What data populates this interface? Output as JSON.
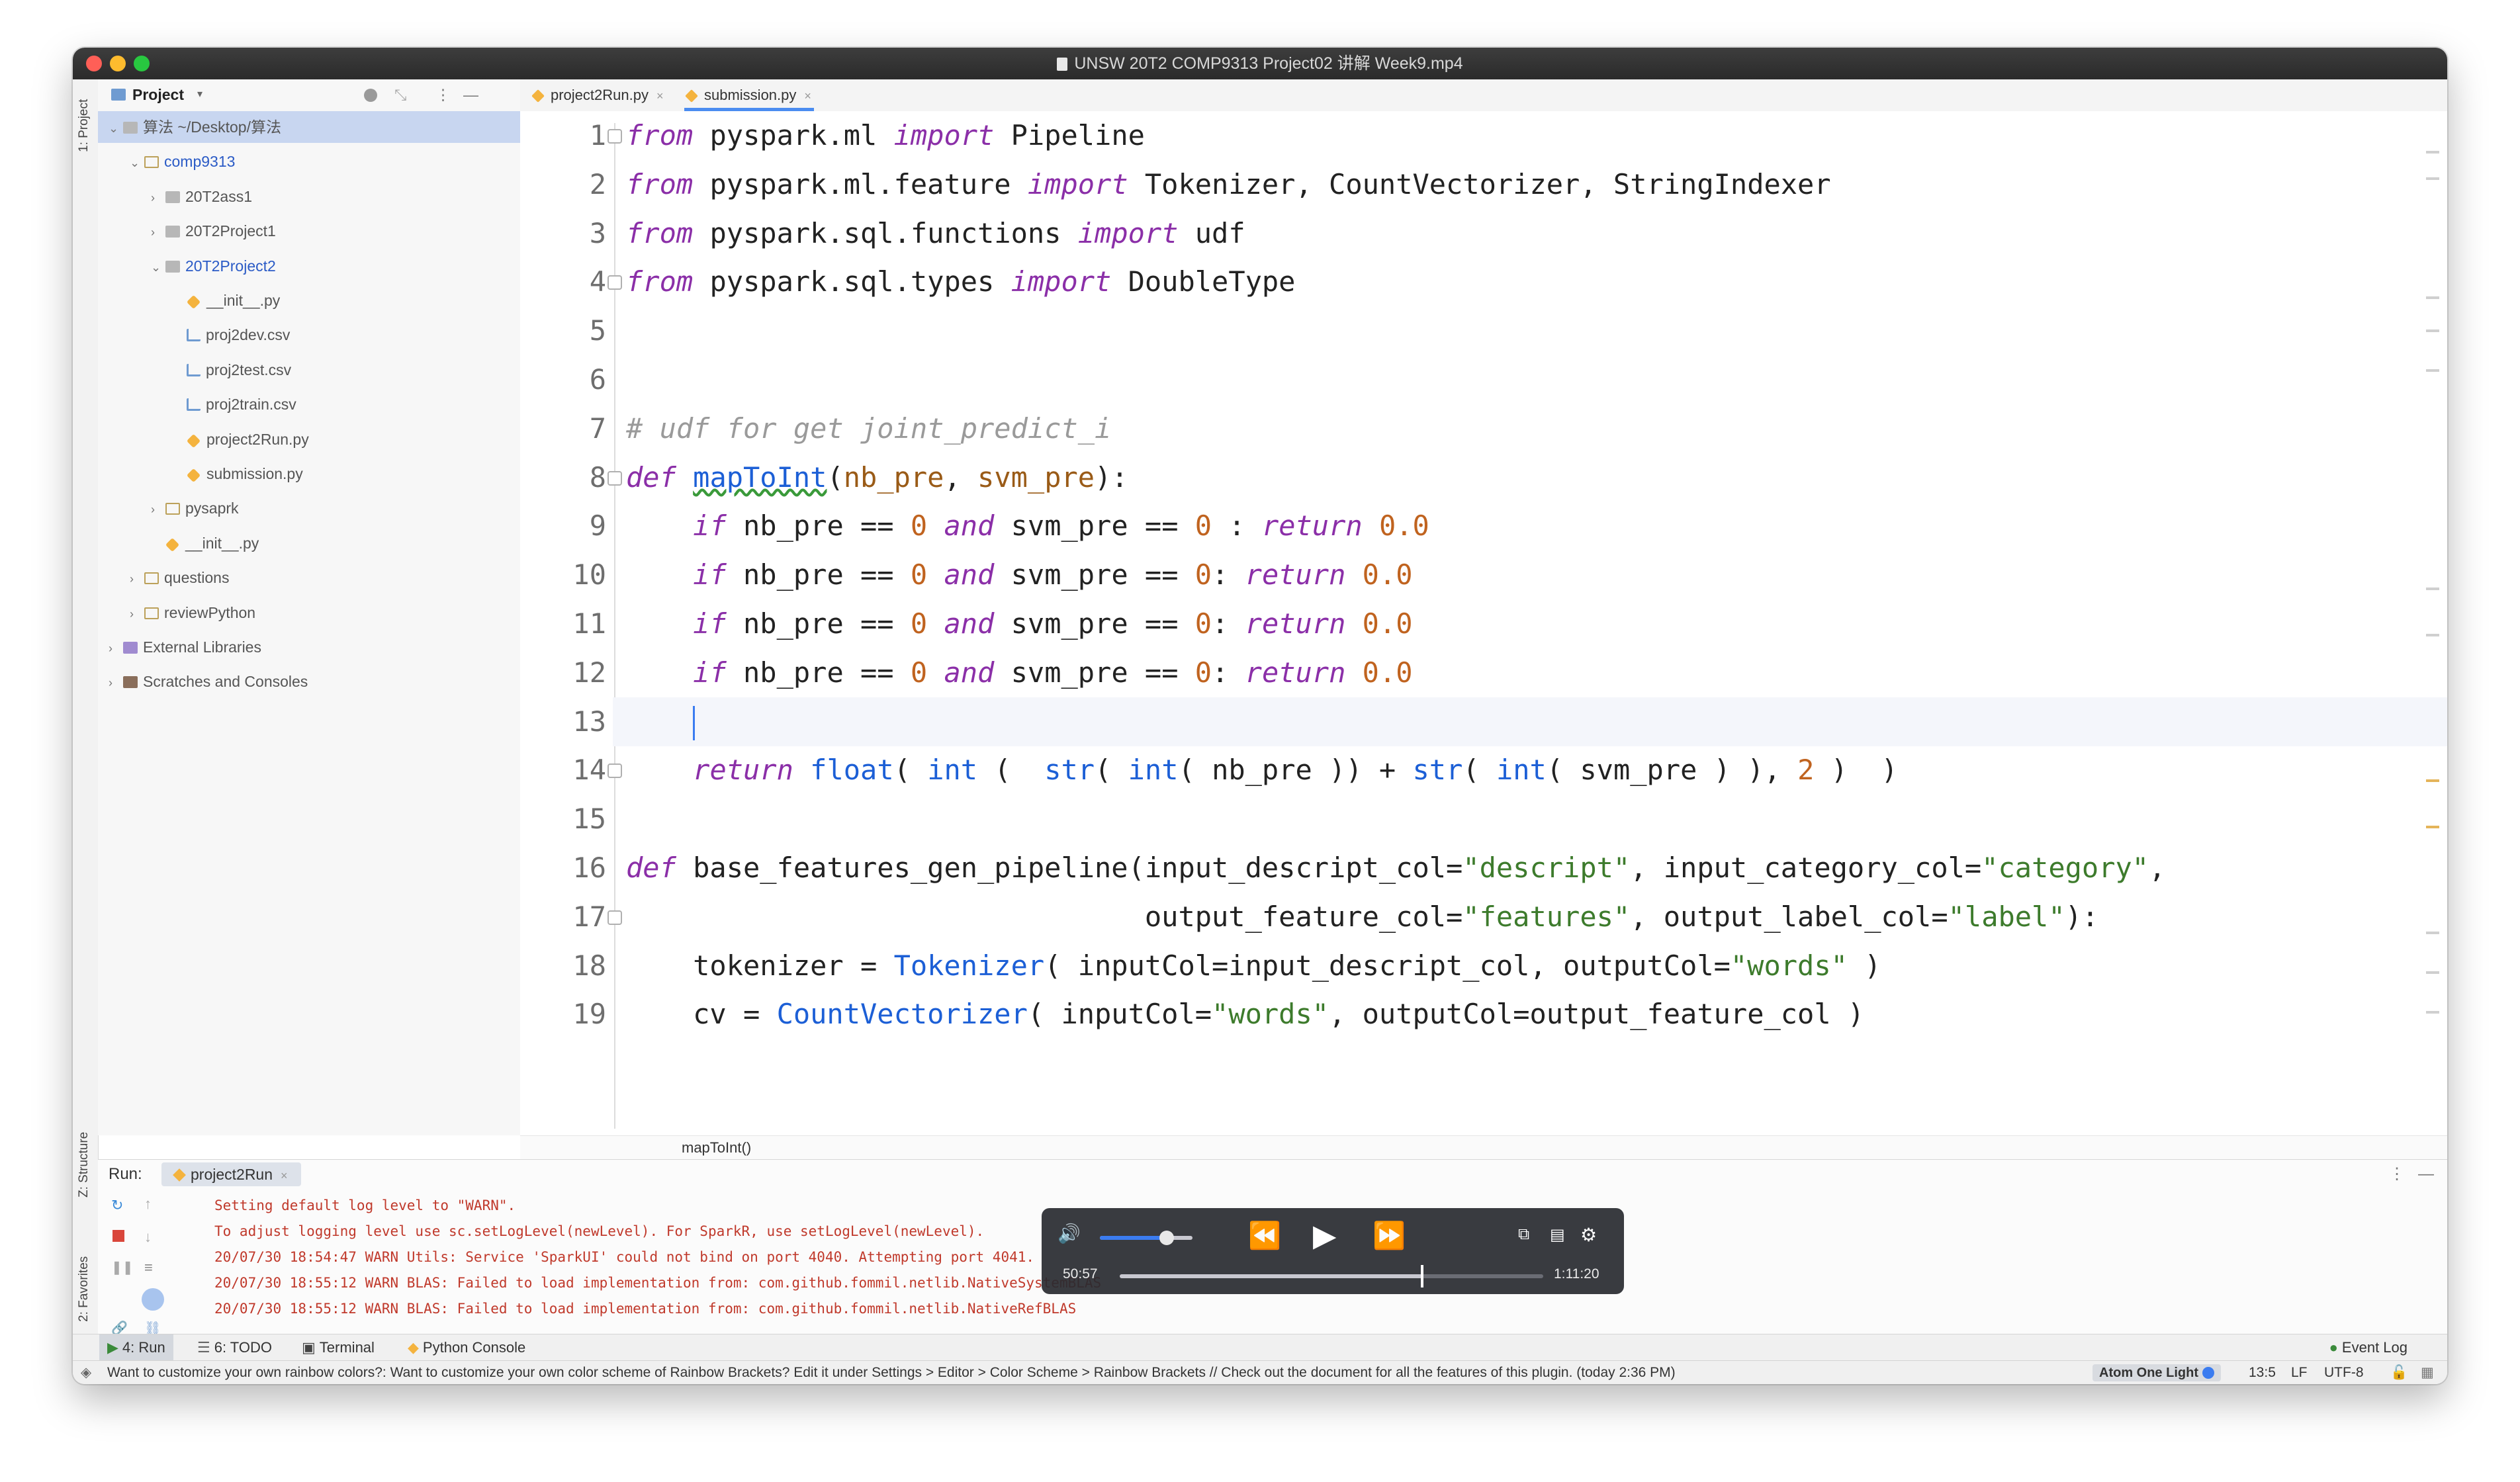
{
  "window": {
    "title": "UNSW 20T2 COMP9313 Project02 讲解 Week9.mp4",
    "traffic_colors": [
      "#ff5f57",
      "#febc2e",
      "#28c840"
    ]
  },
  "left_strip": {
    "project_tab": "1: Project",
    "structure_tab": "Z: Structure",
    "favorites_tab": "2: Favorites"
  },
  "project_panel": {
    "header_label": "Project",
    "tree": [
      {
        "label": "算法  ~/Desktop/算法",
        "indent": 0,
        "icon": "folder",
        "expanded": true,
        "selected": true
      },
      {
        "label": "comp9313",
        "indent": 1,
        "icon": "package",
        "expanded": true,
        "blue": true
      },
      {
        "label": "20T2ass1",
        "indent": 2,
        "icon": "folder",
        "expanded": false
      },
      {
        "label": "20T2Project1",
        "indent": 2,
        "icon": "folder",
        "expanded": false
      },
      {
        "label": "20T2Project2",
        "indent": 2,
        "icon": "folder",
        "expanded": true,
        "blue": true
      },
      {
        "label": "__init__.py",
        "indent": 3,
        "icon": "python"
      },
      {
        "label": "proj2dev.csv",
        "indent": 3,
        "icon": "csv"
      },
      {
        "label": "proj2test.csv",
        "indent": 3,
        "icon": "csv"
      },
      {
        "label": "proj2train.csv",
        "indent": 3,
        "icon": "csv"
      },
      {
        "label": "project2Run.py",
        "indent": 3,
        "icon": "python"
      },
      {
        "label": "submission.py",
        "indent": 3,
        "icon": "python"
      },
      {
        "label": "pysaprk",
        "indent": 2,
        "icon": "package",
        "expanded": false
      },
      {
        "label": "__init__.py",
        "indent": 2,
        "icon": "python",
        "leaf": true
      },
      {
        "label": "questions",
        "indent": 1,
        "icon": "package",
        "expanded": false
      },
      {
        "label": "reviewPython",
        "indent": 1,
        "icon": "package",
        "expanded": false
      },
      {
        "label": "External Libraries",
        "indent": 0,
        "icon": "library",
        "expanded": false
      },
      {
        "label": "Scratches and Consoles",
        "indent": 0,
        "icon": "scratch",
        "expanded": false
      }
    ]
  },
  "editor_tabs": [
    {
      "label": "project2Run.py",
      "active": false
    },
    {
      "label": "submission.py",
      "active": true
    }
  ],
  "code_lines": [
    {
      "n": "1",
      "tokens": [
        [
          "kw",
          "from"
        ],
        [
          "t",
          " pyspark.ml "
        ],
        [
          "kw",
          "import"
        ],
        [
          "t",
          " Pipeline"
        ]
      ]
    },
    {
      "n": "2",
      "tokens": [
        [
          "kw",
          "from"
        ],
        [
          "t",
          " pyspark.ml.feature "
        ],
        [
          "kw",
          "import"
        ],
        [
          "t",
          " Tokenizer, CountVectorizer, StringIndexer"
        ]
      ]
    },
    {
      "n": "3",
      "tokens": [
        [
          "kw",
          "from"
        ],
        [
          "t",
          " pyspark.sql.functions "
        ],
        [
          "kw",
          "import"
        ],
        [
          "t",
          " udf"
        ]
      ]
    },
    {
      "n": "4",
      "tokens": [
        [
          "kw",
          "from"
        ],
        [
          "t",
          " pyspark.sql.types "
        ],
        [
          "kw",
          "import"
        ],
        [
          "t",
          " DoubleType"
        ]
      ]
    },
    {
      "n": "5",
      "tokens": []
    },
    {
      "n": "6",
      "tokens": []
    },
    {
      "n": "7",
      "tokens": [
        [
          "cmt",
          "# udf for get joint_predict_i"
        ]
      ]
    },
    {
      "n": "8",
      "tokens": [
        [
          "kw",
          "def"
        ],
        [
          "t",
          " "
        ],
        [
          "fnu",
          "mapToInt"
        ],
        [
          "t",
          "("
        ],
        [
          "param",
          "nb_pre"
        ],
        [
          "t",
          ", "
        ],
        [
          "param",
          "svm_pre"
        ],
        [
          "t",
          "):"
        ]
      ]
    },
    {
      "n": "9",
      "tokens": [
        [
          "t",
          "    "
        ],
        [
          "kw",
          "if"
        ],
        [
          "t",
          " nb_pre == "
        ],
        [
          "num",
          "0"
        ],
        [
          "t",
          " "
        ],
        [
          "kw",
          "and"
        ],
        [
          "t",
          " svm_pre == "
        ],
        [
          "num",
          "0"
        ],
        [
          "t",
          " : "
        ],
        [
          "kw",
          "return"
        ],
        [
          "t",
          " "
        ],
        [
          "num",
          "0.0"
        ]
      ]
    },
    {
      "n": "10",
      "tokens": [
        [
          "t",
          "    "
        ],
        [
          "kw",
          "if"
        ],
        [
          "t",
          " nb_pre == "
        ],
        [
          "num",
          "0"
        ],
        [
          "t",
          " "
        ],
        [
          "kw",
          "and"
        ],
        [
          "t",
          " svm_pre == "
        ],
        [
          "num",
          "0"
        ],
        [
          "t",
          ": "
        ],
        [
          "kw",
          "return"
        ],
        [
          "t",
          " "
        ],
        [
          "num",
          "0.0"
        ]
      ]
    },
    {
      "n": "11",
      "tokens": [
        [
          "t",
          "    "
        ],
        [
          "kw",
          "if"
        ],
        [
          "t",
          " nb_pre == "
        ],
        [
          "num",
          "0"
        ],
        [
          "t",
          " "
        ],
        [
          "kw",
          "and"
        ],
        [
          "t",
          " svm_pre == "
        ],
        [
          "num",
          "0"
        ],
        [
          "t",
          ": "
        ],
        [
          "kw",
          "return"
        ],
        [
          "t",
          " "
        ],
        [
          "num",
          "0.0"
        ]
      ]
    },
    {
      "n": "12",
      "tokens": [
        [
          "t",
          "    "
        ],
        [
          "kw",
          "if"
        ],
        [
          "t",
          " nb_pre == "
        ],
        [
          "num",
          "0"
        ],
        [
          "t",
          " "
        ],
        [
          "kw",
          "and"
        ],
        [
          "t",
          " svm_pre == "
        ],
        [
          "num",
          "0"
        ],
        [
          "t",
          ": "
        ],
        [
          "kw",
          "return"
        ],
        [
          "t",
          " "
        ],
        [
          "num",
          "0.0"
        ]
      ]
    },
    {
      "n": "13",
      "tokens": [
        [
          "t",
          "    "
        ],
        [
          "caret",
          ""
        ]
      ],
      "current": true
    },
    {
      "n": "14",
      "tokens": [
        [
          "t",
          "    "
        ],
        [
          "kw",
          "return"
        ],
        [
          "t",
          " "
        ],
        [
          "fn",
          "float"
        ],
        [
          "t",
          "( "
        ],
        [
          "fn",
          "int"
        ],
        [
          "t",
          " (  "
        ],
        [
          "fn",
          "str"
        ],
        [
          "t",
          "( "
        ],
        [
          "fn",
          "int"
        ],
        [
          "t",
          "( nb_pre )) + "
        ],
        [
          "fn",
          "str"
        ],
        [
          "t",
          "( "
        ],
        [
          "fn",
          "int"
        ],
        [
          "t",
          "( svm_pre ) ), "
        ],
        [
          "num",
          "2"
        ],
        [
          "t",
          " )  )"
        ]
      ]
    },
    {
      "n": "15",
      "tokens": []
    },
    {
      "n": "16",
      "tokens": [
        [
          "kw",
          "def"
        ],
        [
          "t",
          " base_features_gen_pipeline(input_descript_col="
        ],
        [
          "str",
          "\"descript\""
        ],
        [
          "t",
          ", input_category_col="
        ],
        [
          "str",
          "\"category\""
        ],
        [
          "t",
          ","
        ]
      ]
    },
    {
      "n": "17",
      "tokens": [
        [
          "t",
          "                               output_feature_col="
        ],
        [
          "str",
          "\"features\""
        ],
        [
          "t",
          ", output_label_col="
        ],
        [
          "str",
          "\"label\""
        ],
        [
          "t",
          "):"
        ]
      ]
    },
    {
      "n": "18",
      "tokens": [
        [
          "t",
          "    tokenizer = "
        ],
        [
          "fn",
          "Tokenizer"
        ],
        [
          "t",
          "( inputCol=input_descript_col, outputCol="
        ],
        [
          "str",
          "\"words\""
        ],
        [
          "t",
          " )"
        ]
      ]
    },
    {
      "n": "19",
      "tokens": [
        [
          "t",
          "    cv = "
        ],
        [
          "fn",
          "CountVectorizer"
        ],
        [
          "t",
          "( inputCol="
        ],
        [
          "str",
          "\"words\""
        ],
        [
          "t",
          ", outputCol=output_feature_col )"
        ]
      ]
    }
  ],
  "breadcrumb": "mapToInt()",
  "run_panel": {
    "label": "Run:",
    "tab": "project2Run",
    "lines": [
      "Setting default log level to \"WARN\".",
      "To adjust logging level use sc.setLogLevel(newLevel). For SparkR, use setLogLevel(newLevel).",
      "20/07/30 18:54:47 WARN Utils: Service 'SparkUI' could not bind on port 4040. Attempting port 4041.",
      "20/07/30 18:55:12 WARN BLAS: Failed to load implementation from: com.github.fommil.netlib.NativeSystemBLAS",
      "20/07/30 18:55:12 WARN BLAS: Failed to load implementation from: com.github.fommil.netlib.NativeRefBLAS"
    ]
  },
  "tool_windows": [
    {
      "label": "4: Run",
      "active": true
    },
    {
      "label": "6: TODO"
    },
    {
      "label": "Terminal"
    },
    {
      "label": "Python Console"
    }
  ],
  "event_log": "Event Log",
  "status": {
    "message": "Want to customize your own rainbow colors?:    Want to customize your own color scheme of Rainbow Brackets? Edit it under    Settings > Editor > Color Scheme > Rainbow Brackets    //    Check out the document for all the features of this plugin.    (today 2:36 PM)",
    "theme": "Atom One Light",
    "position": "13:5",
    "line_sep": "LF",
    "encoding": "UTF-8"
  },
  "player": {
    "elapsed": "50:57",
    "duration": "1:11:20",
    "progress": 0.714,
    "volume": 0.72
  },
  "colors": {
    "accent": "#4b8cf0",
    "keyword": "#8b2fa8",
    "function": "#1c5fd6",
    "string": "#3d7b2c",
    "number": "#c0631f",
    "console_error": "#c0392b"
  }
}
